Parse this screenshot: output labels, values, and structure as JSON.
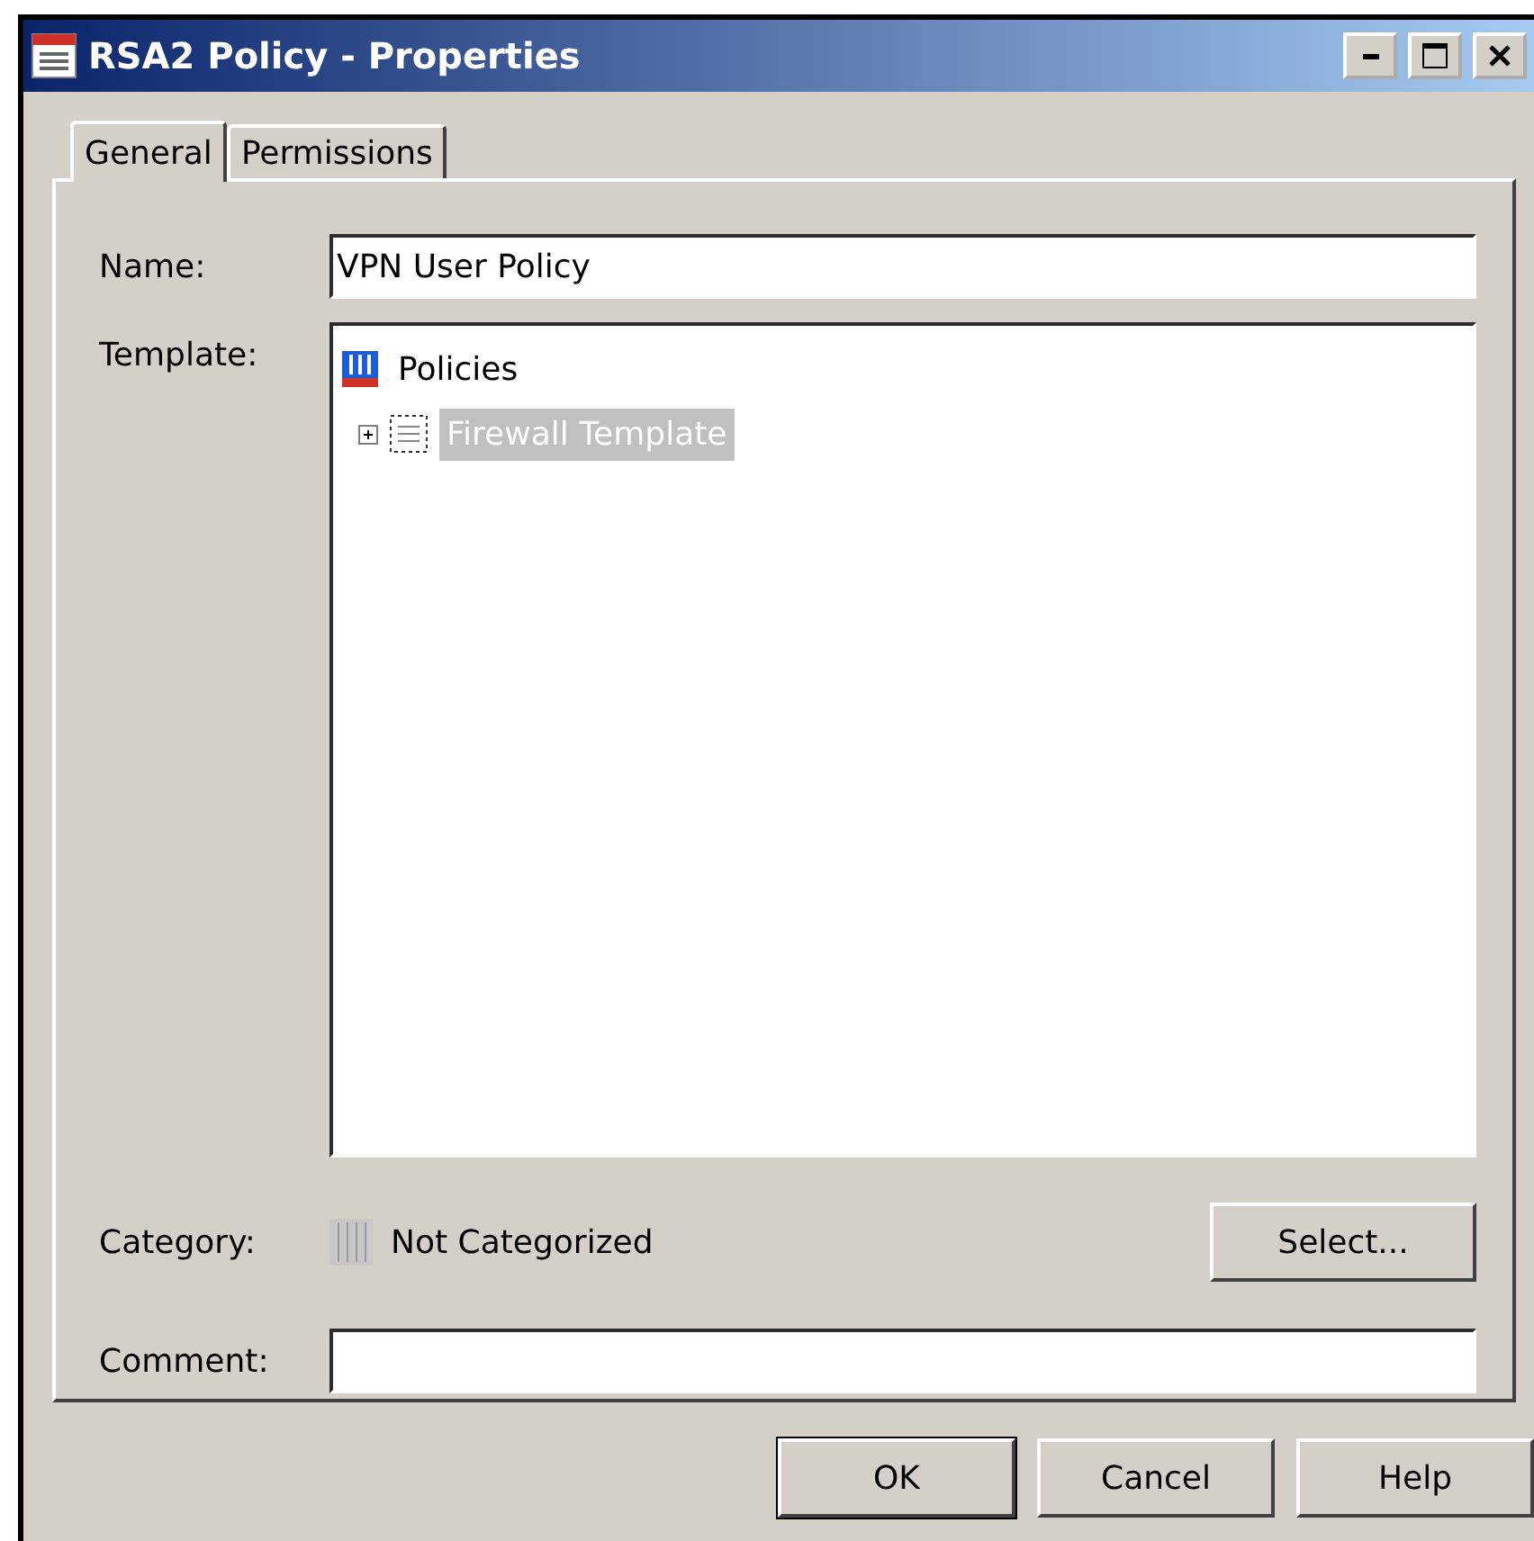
{
  "window": {
    "title": "RSA2 Policy - Properties"
  },
  "tabs": [
    {
      "label": "General",
      "selected": true
    },
    {
      "label": "Permissions",
      "selected": false
    }
  ],
  "name_field": {
    "label": "Name:",
    "value": "VPN User Policy"
  },
  "template": {
    "label": "Template:",
    "tree": [
      {
        "label": "Policies",
        "selected": false,
        "children": [
          {
            "label": "Firewall Template",
            "selected": true,
            "expanded": false
          }
        ]
      }
    ]
  },
  "category": {
    "label": "Category:",
    "value": "Not Categorized",
    "button": "Select..."
  },
  "comment_field": {
    "label": "Comment:"
  },
  "buttons": [
    "OK",
    "Cancel",
    "Help"
  ]
}
